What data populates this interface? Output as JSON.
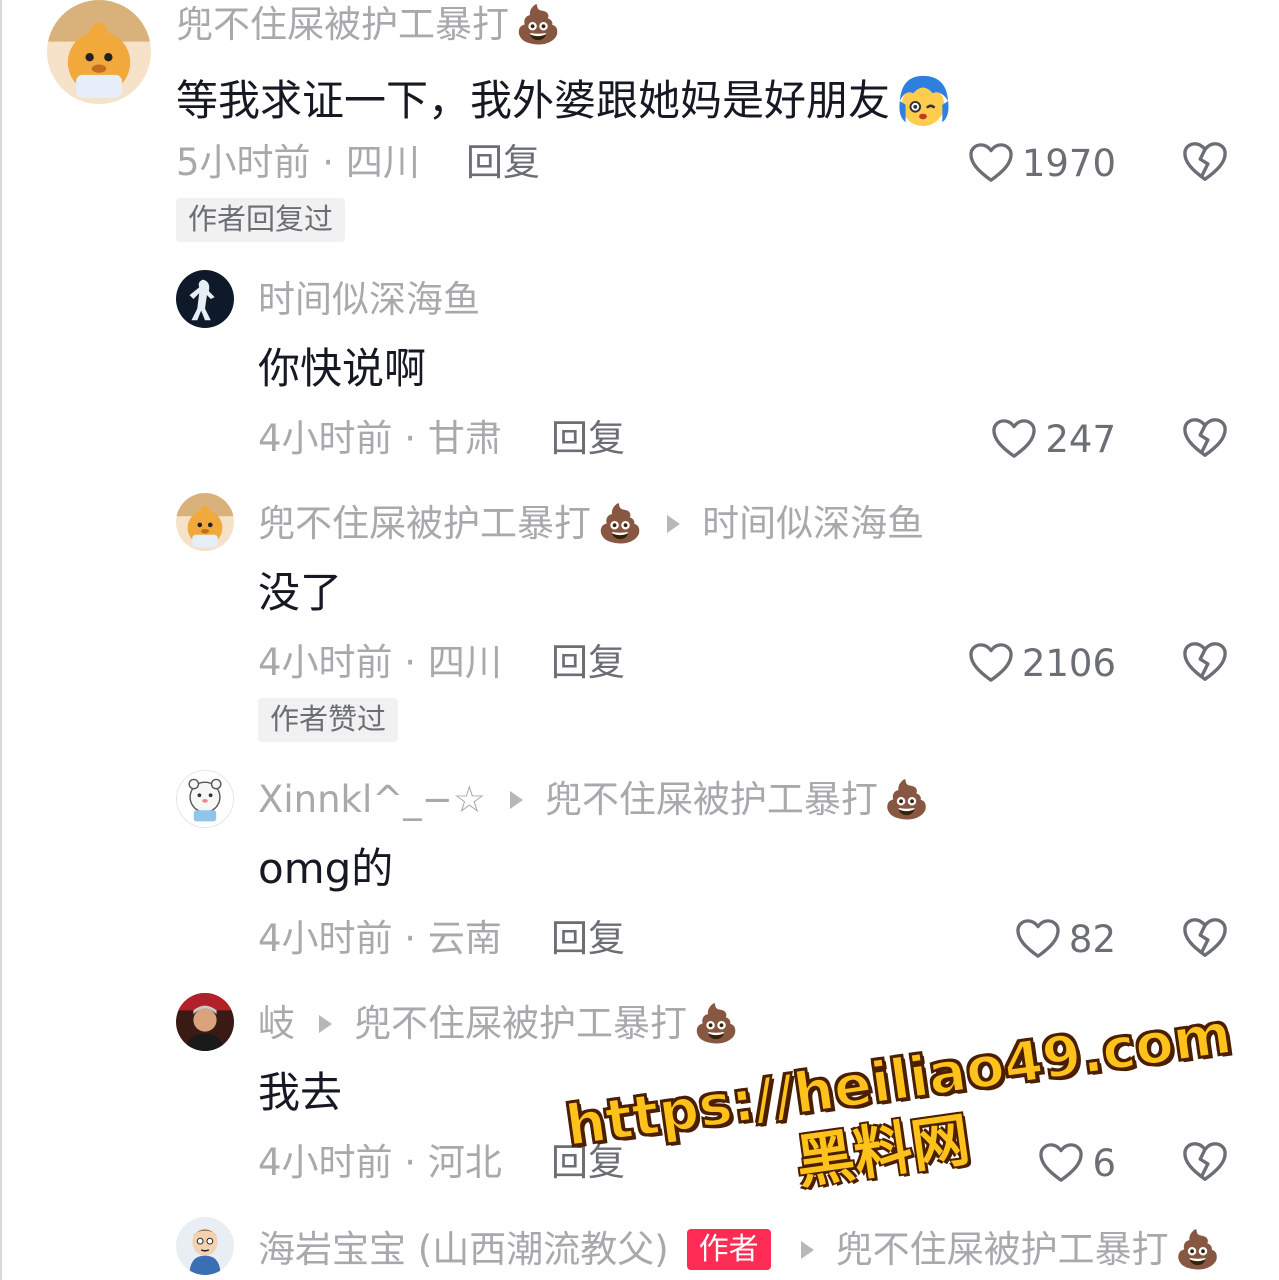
{
  "comments": [
    {
      "username": "兜不住屎被护工暴打",
      "username_emoji": "💩",
      "reply_to": "",
      "text": "等我求证一下，我外婆跟她妈是好朋友",
      "text_emoji": "blushing-blue-hair-emoji",
      "time": "5小时前",
      "location": "四川",
      "reply_label": "回复",
      "likes": "1970",
      "tag": "作者回复过"
    },
    {
      "username": "时间似深海鱼",
      "reply_to": "",
      "text": "你快说啊",
      "time": "4小时前",
      "location": "甘肃",
      "reply_label": "回复",
      "likes": "247"
    },
    {
      "username": "兜不住屎被护工暴打",
      "username_emoji": "💩",
      "reply_to": "时间似深海鱼",
      "text": "没了",
      "time": "4小时前",
      "location": "四川",
      "reply_label": "回复",
      "likes": "2106",
      "tag": "作者赞过"
    },
    {
      "username": "Xinnkl^_−☆",
      "reply_to": "兜不住屎被护工暴打",
      "reply_to_emoji": "💩",
      "text": "omg的",
      "time": "4小时前",
      "location": "云南",
      "reply_label": "回复",
      "likes": "82"
    },
    {
      "username": "岐",
      "reply_to": "兜不住屎被护工暴打",
      "reply_to_emoji": "💩",
      "text": "我去",
      "time": "4小时前",
      "location": "河北",
      "reply_label": "回复",
      "likes": "6"
    },
    {
      "username": "海岩宝宝 (山西潮流教父)",
      "author_badge": "作者",
      "reply_to": "兜不住屎被护工暴打",
      "reply_to_emoji": "💩"
    }
  ],
  "watermark": {
    "url": "https://heiliao49.com",
    "name": "黑料网"
  },
  "colors": {
    "secondary_text": "#a7a9ad",
    "primary_text": "#161823",
    "author_badge": "#fe2c55",
    "watermark": "#ffc21a"
  }
}
